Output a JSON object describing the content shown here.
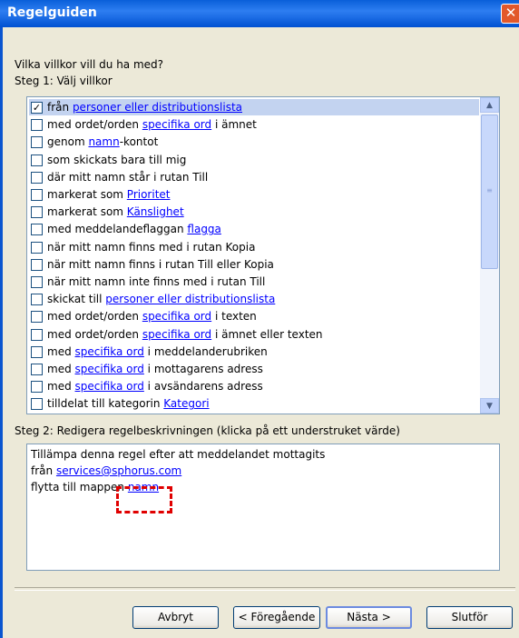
{
  "window": {
    "title": "Regelguiden"
  },
  "prompt": "Vilka villkor vill du ha med?",
  "step1": {
    "label": "Steg 1: Välj villkor"
  },
  "conditions": [
    {
      "checked": true,
      "pre": "från ",
      "link": "personer eller distributionslista",
      "post": ""
    },
    {
      "checked": false,
      "pre": "med ordet/orden ",
      "link": "specifika ord",
      "post": " i ämnet"
    },
    {
      "checked": false,
      "pre": "genom ",
      "link": "namn",
      "post": "-kontot"
    },
    {
      "checked": false,
      "pre": "som skickats bara till mig",
      "link": "",
      "post": ""
    },
    {
      "checked": false,
      "pre": "där mitt namn står i rutan Till",
      "link": "",
      "post": ""
    },
    {
      "checked": false,
      "pre": "markerat som ",
      "link": "Prioritet",
      "post": ""
    },
    {
      "checked": false,
      "pre": "markerat som ",
      "link": "Känslighet",
      "post": ""
    },
    {
      "checked": false,
      "pre": "med meddelandeflaggan ",
      "link": "flagga",
      "post": ""
    },
    {
      "checked": false,
      "pre": "när mitt namn finns med i rutan Kopia",
      "link": "",
      "post": ""
    },
    {
      "checked": false,
      "pre": "när mitt namn finns i rutan Till eller Kopia",
      "link": "",
      "post": ""
    },
    {
      "checked": false,
      "pre": "när mitt namn inte finns med i rutan Till",
      "link": "",
      "post": ""
    },
    {
      "checked": false,
      "pre": "skickat till ",
      "link": "personer eller distributionslista",
      "post": ""
    },
    {
      "checked": false,
      "pre": "med ordet/orden ",
      "link": "specifika ord",
      "post": " i texten"
    },
    {
      "checked": false,
      "pre": "med ordet/orden ",
      "link": "specifika ord",
      "post": " i ämnet eller texten"
    },
    {
      "checked": false,
      "pre": "med ",
      "link": "specifika ord",
      "post": " i meddelanderubriken"
    },
    {
      "checked": false,
      "pre": "med ",
      "link": "specifika ord",
      "post": " i mottagarens adress"
    },
    {
      "checked": false,
      "pre": "med ",
      "link": "specifika ord",
      "post": " i avsändarens adress"
    },
    {
      "checked": false,
      "pre": "tilldelat till kategorin ",
      "link": "Kategori",
      "post": ""
    }
  ],
  "step2": {
    "label": "Steg 2: Redigera regelbeskrivningen (klicka på ett understruket värde)"
  },
  "description": {
    "line1": "Tillämpa denna regel efter att meddelandet mottagits",
    "line2_pre": "från ",
    "line2_link": "services@sphorus.com",
    "line3_pre": "flytta till mappen ",
    "line3_link": "namn"
  },
  "buttons": {
    "cancel": "Avbryt",
    "back": "< Föregående",
    "next": "Nästa >",
    "finish": "Slutför"
  },
  "colors": {
    "link": "#0000FF",
    "highlight": "#E00000",
    "selected_row": "#C3D3F0"
  }
}
